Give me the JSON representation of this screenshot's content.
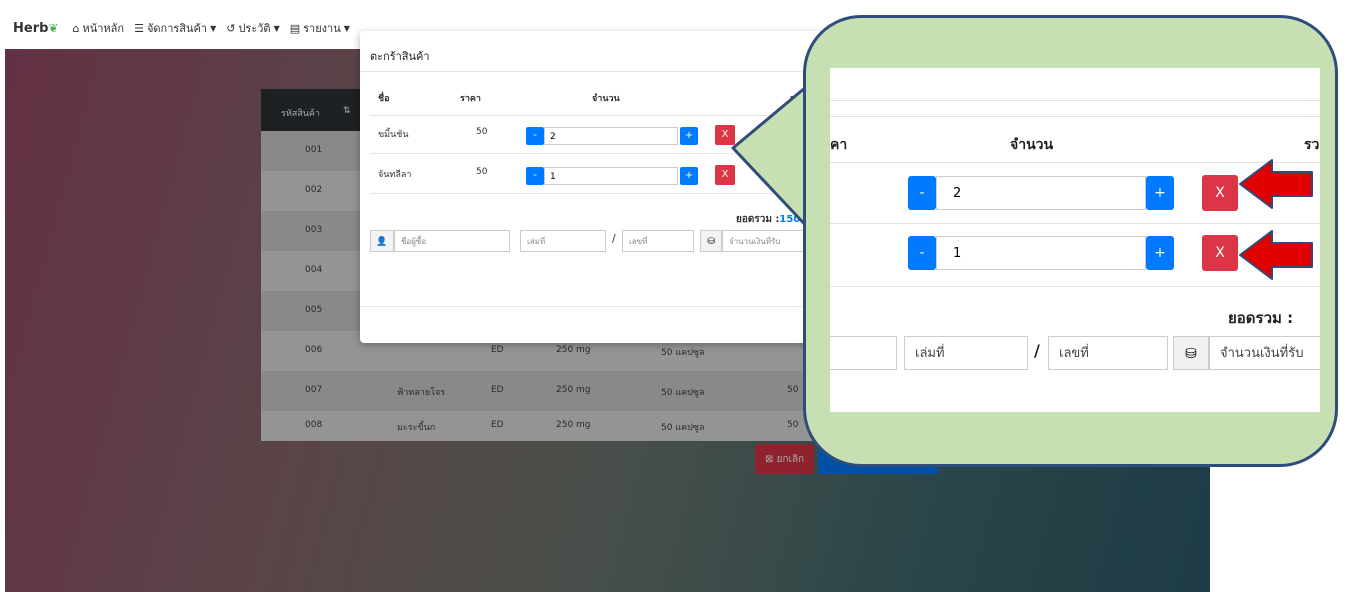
{
  "navbar": {
    "brand": "Herb",
    "home": "หน้าหลัก",
    "manage": "จัดการสินค้า",
    "history": "ประวัติ",
    "report": "รายงาน",
    "icons": {
      "brand": "leaf-icon",
      "home": "home-icon",
      "manage": "list-icon",
      "history": "history-icon",
      "report": "report-icon"
    }
  },
  "background_table": {
    "header_code": "รหัสสินค้า",
    "rows": [
      {
        "code": "001"
      },
      {
        "code": "002"
      },
      {
        "code": "003"
      },
      {
        "code": "004"
      },
      {
        "code": "005"
      },
      {
        "code": "006",
        "col3": "ED",
        "col4": "250 mg",
        "col5": "50 แคปซูล"
      },
      {
        "code": "007",
        "name": "ฟ้าทลายโจร",
        "col3": "ED",
        "col4": "250 mg",
        "col5": "50 แคปซูล",
        "col6": "50"
      },
      {
        "code": "008",
        "name": "มะระขี้นก",
        "col3": "ED",
        "col4": "250 mg",
        "col5": "50 แคปซูล",
        "col6": "50"
      }
    ],
    "cancel_label": "ยกเลิก"
  },
  "cart": {
    "title": "ตะกร้าสินค้า",
    "headers": {
      "name": "ชื่อ",
      "price": "ราคา",
      "qty": "จำนวน",
      "total": "รวม"
    },
    "items": [
      {
        "name": "ขมิ้นชัน",
        "price": "50",
        "qty": "2"
      },
      {
        "name": "จันทลีลา",
        "price": "50",
        "qty": "1"
      }
    ],
    "minus_label": "-",
    "plus_label": "+",
    "remove_label": "X",
    "grand_total_label": "ยอดรวม :",
    "grand_total_value": "150",
    "buyer_placeholder": "ชื่อผู้ซื้อ",
    "book_placeholder": "เล่มที่",
    "slash": "/",
    "number_placeholder": "เลขที่",
    "amount_placeholder": "จำนวนเงินที่รับ"
  },
  "zoom": {
    "price_fragment": "คา",
    "qty_header": "จำนวน",
    "total_fragment": "รว",
    "grand_total_label": "ยอดรวม :"
  },
  "colors": {
    "primary": "#007bff",
    "danger": "#dc3545",
    "callout_fill": "#c6e0b4",
    "callout_border": "#2e4d7a",
    "arrow": "#e00000"
  }
}
